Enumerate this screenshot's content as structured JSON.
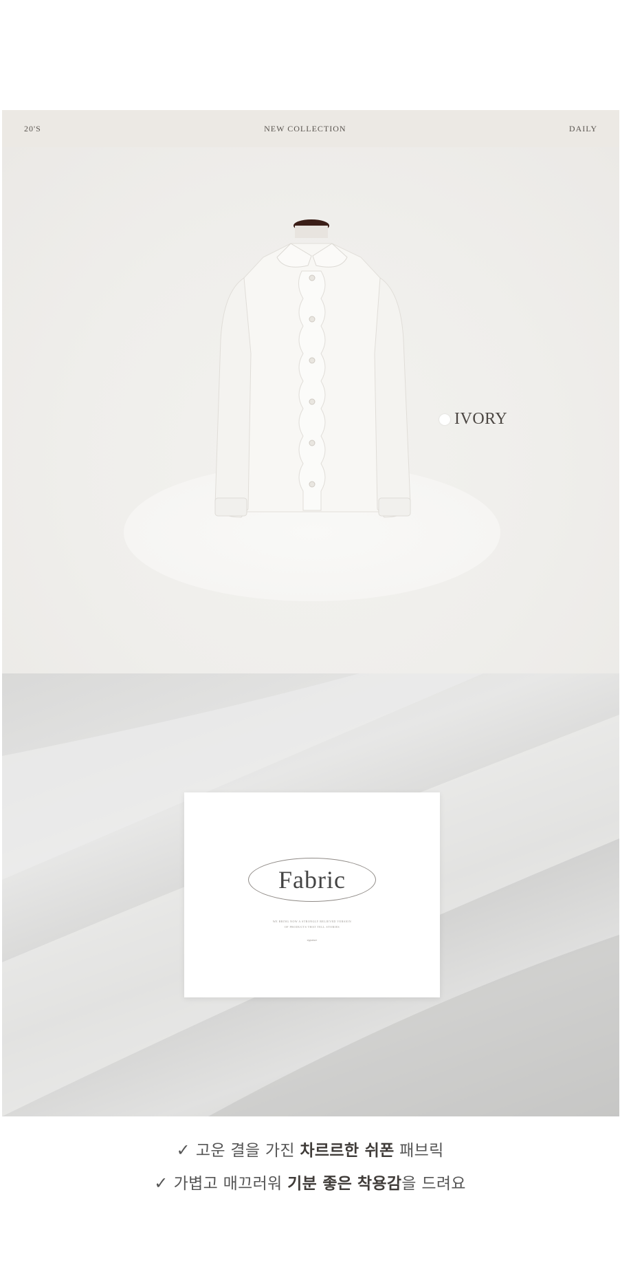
{
  "header": {
    "left_label": "20'S",
    "center_label": "NEW COLLECTION",
    "right_label": "DAILY"
  },
  "product": {
    "color_name": "IVORY",
    "swatch_color": "#ffffff"
  },
  "fabric_card": {
    "title": "Fabric",
    "fine_line_1": "WE BRING NOW A STRONGLY BELIEVED VERSION",
    "fine_line_2": "OF PRODUCTS THAT TELL STORIES",
    "fine_sign": "signature"
  },
  "bullets": {
    "check_icon": "✓",
    "line1": {
      "pre": "고운 결을 가진 ",
      "bold": "차르르한 쉬폰",
      "post": " 패브릭"
    },
    "line2": {
      "pre": "가볍고 매끄러워 ",
      "bold1": "기분 좋은",
      "mid": " ",
      "bold2": "착용감",
      "post": "을 드려요"
    }
  },
  "colors": {
    "banner_bg": "#ece9e4",
    "stage_bg": "#efeeeb",
    "text_dark": "#4b4642"
  }
}
